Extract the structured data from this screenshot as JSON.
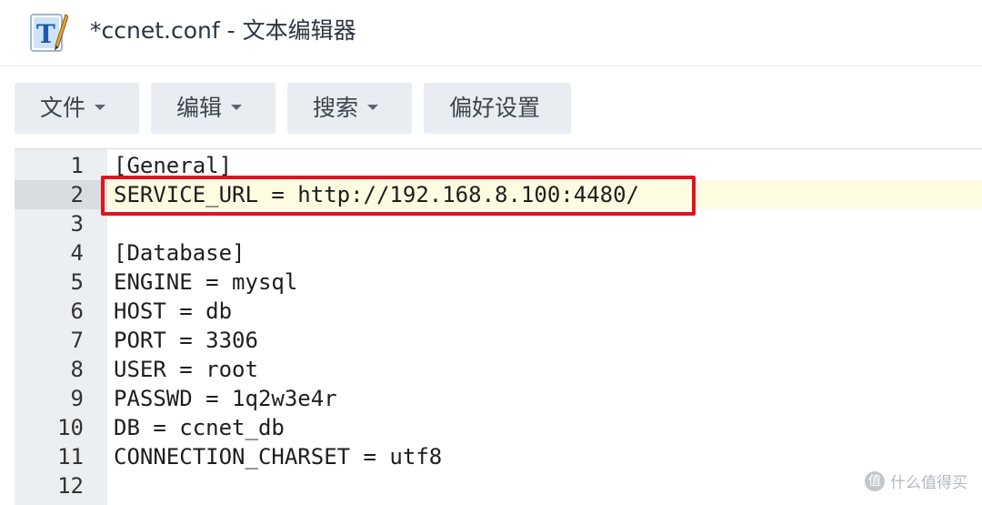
{
  "window": {
    "title": "*ccnet.conf - 文本编辑器",
    "icon": "text-editor-app-icon"
  },
  "menu": {
    "file": "文件",
    "edit": "编辑",
    "search": "搜索",
    "preferences": "偏好设置"
  },
  "editor": {
    "active_line": 2,
    "highlighted_line": 2,
    "lines": [
      {
        "num": "1",
        "text": "[General]"
      },
      {
        "num": "2",
        "text": "SERVICE_URL = http://192.168.8.100:4480/"
      },
      {
        "num": "3",
        "text": ""
      },
      {
        "num": "4",
        "text": "[Database]"
      },
      {
        "num": "5",
        "text": "ENGINE = mysql"
      },
      {
        "num": "6",
        "text": "HOST = db"
      },
      {
        "num": "7",
        "text": "PORT = 3306"
      },
      {
        "num": "8",
        "text": "USER = root"
      },
      {
        "num": "9",
        "text": "PASSWD = 1q2w3e4r"
      },
      {
        "num": "10",
        "text": "DB = ccnet_db"
      },
      {
        "num": "11",
        "text": "CONNECTION_CHARSET = utf8"
      },
      {
        "num": "12",
        "text": ""
      }
    ]
  },
  "watermark": {
    "icon_glyph": "值",
    "text": "什么值得买"
  },
  "colors": {
    "highlight_border": "#e0141e",
    "active_line_bg": "#fdfbe0",
    "gutter_bg": "#eceff2",
    "menu_button_bg": "#e9edf1"
  }
}
